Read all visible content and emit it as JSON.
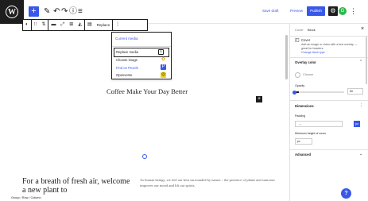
{
  "topbar": {
    "logo_glyph": "W",
    "inserter_glyph": "+",
    "tools": [
      {
        "icon": "pencil-icon",
        "glyph": "✎"
      },
      {
        "icon": "undo-icon",
        "glyph": "↶"
      },
      {
        "icon": "redo-icon",
        "glyph": "↷"
      },
      {
        "icon": "info-icon",
        "glyph": "ⓘ"
      },
      {
        "icon": "list-view-icon",
        "glyph": "≡"
      }
    ],
    "save_draft": "Save draft",
    "preview": "Preview",
    "publish": "Publish",
    "settings_glyph": "⚙",
    "plugin_glyph": "G",
    "options_glyph": "⋮"
  },
  "block_toolbar": {
    "items": [
      {
        "icon": "cover-block-icon",
        "glyph": "◐"
      },
      {
        "icon": "drag-handle-icon",
        "glyph": "⁝⁝"
      },
      {
        "icon": "move-updown-icon",
        "glyph": "⇅"
      },
      {
        "icon": "align-icon",
        "glyph": "▬"
      },
      {
        "icon": "fullscreen-icon",
        "glyph": "⤢"
      },
      {
        "icon": "position-icon",
        "glyph": "⊞"
      },
      {
        "icon": "duotone-icon",
        "glyph": "◭"
      },
      {
        "icon": "focal-icon",
        "glyph": "▤"
      }
    ],
    "replace_label": "Replace",
    "more_glyph": "⋮"
  },
  "dropdown": {
    "current_media": "Current media",
    "items": [
      {
        "label": "Replace media",
        "icon": "upload-icon",
        "glyph": "⤒",
        "color": "#1e1e1e"
      },
      {
        "label": "Choose image",
        "icon": "image-icon",
        "glyph": "✿",
        "color": "#e8a317"
      },
      {
        "label": "Find on Pexels",
        "icon": "pexels-icon",
        "glyph": "P",
        "color": "#3858e9"
      },
      {
        "label": "Openverse",
        "icon": "openverse-icon",
        "glyph": "◎",
        "color": "#f5d800"
      }
    ]
  },
  "canvas": {
    "title": "Coffee Make Your Day Better",
    "add_block_glyph": "+",
    "heading": "For a breath of fresh air, welcome a new plant to",
    "paragraph": "As human beings, we feel our best surrounded by nature – the presence of plants and sunroom improves our mood and lift our spirits."
  },
  "breadcrumb": "Group  /  Row  /  Column",
  "sidebar": {
    "tabs": [
      "Cover",
      "Block"
    ],
    "active_tab": "Block",
    "close_glyph": "×",
    "block": {
      "name": "Cover",
      "description": "Add an image or video with a text overlay — great for headers.",
      "link": "Change block type"
    },
    "panels": {
      "overlay_title": "Overlay color",
      "style_label": "Choose",
      "opacity_label": "Opacity",
      "opacity_value": "50",
      "opacity_fraction": 0.08,
      "settings_title": "Dimensions",
      "padding_label": "Padding",
      "padding_value": "—",
      "unit": "px",
      "min_height_label": "Minimum height of cover",
      "min_height_value": "px",
      "advanced_title": "Advanced"
    },
    "accent": "#3858e9"
  },
  "help_glyph": "?"
}
